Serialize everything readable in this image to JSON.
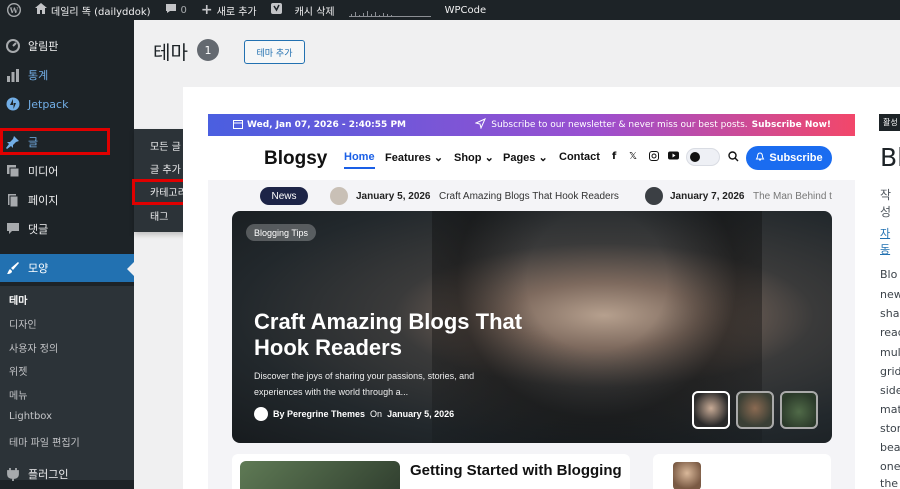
{
  "adminbar": {
    "site_name": "데일리 똑 (dailyddok)",
    "comments_count": "0",
    "new_label": "새로 추가",
    "cache_label": "캐시 삭제",
    "wpcode_label": "WPCode"
  },
  "sidebar": {
    "items": [
      {
        "label": "알림판",
        "icon": "dashboard-icon"
      },
      {
        "label": "통계",
        "icon": "stats-icon"
      },
      {
        "label": "Jetpack",
        "icon": "jetpack-icon"
      },
      {
        "label": "글",
        "icon": "pin-icon"
      },
      {
        "label": "미디어",
        "icon": "media-icon"
      },
      {
        "label": "페이지",
        "icon": "page-icon"
      },
      {
        "label": "댓글",
        "icon": "comment-icon"
      },
      {
        "label": "모양",
        "icon": "brush-icon"
      },
      {
        "label": "플러그인",
        "icon": "plugin-icon"
      }
    ],
    "submenu": [
      "테마",
      "디자인",
      "사용자 정의",
      "위젯",
      "메뉴",
      "Lightbox",
      "테마 파일 편집기"
    ]
  },
  "flyout": {
    "items": [
      "모든 글",
      "글 추가",
      "카테고리",
      "태그"
    ]
  },
  "main": {
    "title": "테마",
    "count": "1",
    "add_theme": "테마 추가"
  },
  "preview": {
    "topbar": {
      "date": "Wed, Jan 07, 2026 - 2:40:55 PM",
      "message": "Subscribe to our newsletter & never miss our best posts.",
      "cta": "Subscribe Now!"
    },
    "logo": "Blogsy",
    "nav": [
      "Home",
      "Features",
      "Shop",
      "Pages",
      "Contact"
    ],
    "subscribe": "Subscribe",
    "ticker": {
      "badge": "News",
      "date1": "January 5, 2026",
      "title1": "Craft Amazing Blogs That Hook Readers",
      "date2": "January 7, 2026",
      "title2": "The Man Behind t"
    },
    "hero": {
      "tag": "Blogging Tips",
      "title": "Craft Amazing Blogs That Hook Readers",
      "desc": "Discover the joys of sharing your passions, stories, and experiences with the world through a...",
      "author": "By Peregrine Themes",
      "on": "On",
      "date": "January 5, 2026"
    },
    "card_title": "Getting Started with Blogging"
  },
  "right": {
    "tag": "활성",
    "title": "Bl",
    "author": "작성",
    "link": "자동",
    "lines": [
      "Blo",
      "new",
      "sha",
      "read",
      "mul",
      "grid",
      "side",
      "mat",
      "stor",
      "bea",
      "one",
      "the"
    ]
  },
  "colors": {
    "accent": "#2271b1",
    "highlight": "#e00000",
    "subscribe": "#1a6cf0"
  }
}
